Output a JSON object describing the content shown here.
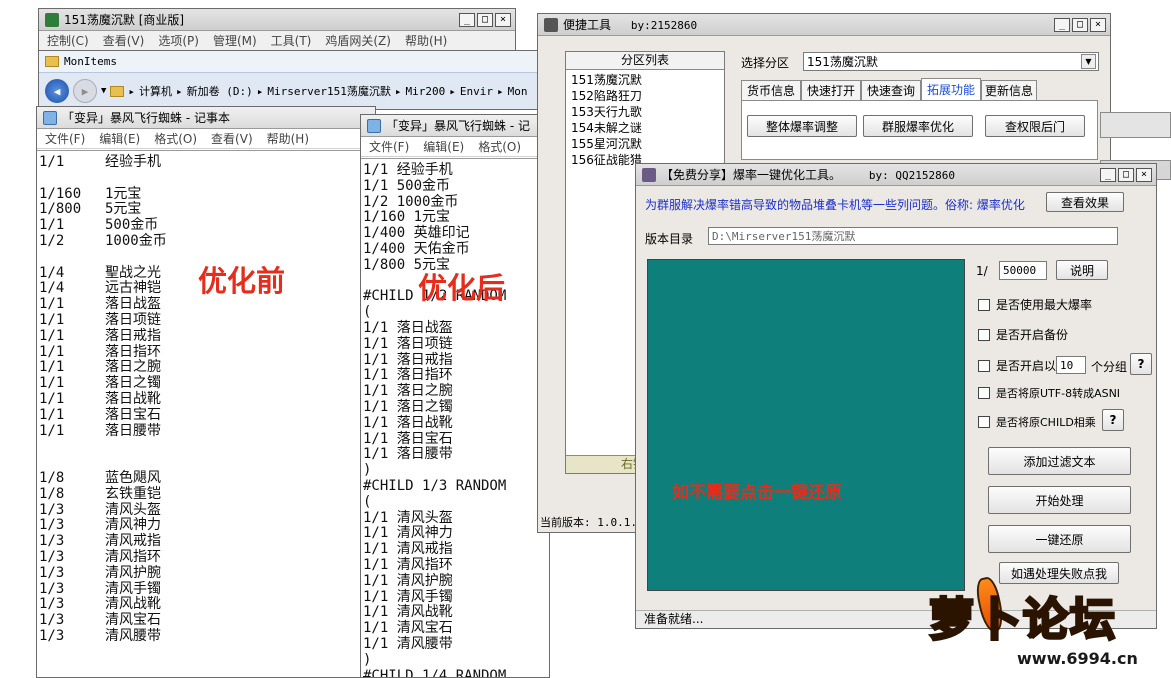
{
  "colors": {
    "overlay_red": "#e52d1c",
    "teal_panel": "#0e7f7a",
    "info_blue": "#1a2fc9",
    "logo_orange": "#ff7a10"
  },
  "game_window": {
    "title": "151荡魔沉默 [商业版]",
    "menu": [
      "控制(C)",
      "查看(V)",
      "选项(P)",
      "管理(M)",
      "工具(T)",
      "鸡盾网关(Z)",
      "帮助(H)"
    ]
  },
  "explorer": {
    "folder_title": "MonItems",
    "breadcrumb": [
      "计算机",
      "新加卷 (D:)",
      "Mirserver151荡魔沉默",
      "Mir200",
      "Envir",
      "Mon"
    ]
  },
  "notepad_before": {
    "title": "「变异」暴风飞行蜘蛛 - 记事本",
    "menu": [
      "文件(F)",
      "编辑(E)",
      "格式(O)",
      "查看(V)",
      "帮助(H)"
    ],
    "rows": [
      {
        "r": "1/1",
        "n": "经验手机"
      },
      {
        "r": "",
        "n": ""
      },
      {
        "r": "1/160",
        "n": "1元宝"
      },
      {
        "r": "1/800",
        "n": "5元宝"
      },
      {
        "r": "1/1",
        "n": "500金币"
      },
      {
        "r": "1/2",
        "n": "1000金币"
      },
      {
        "r": "",
        "n": ""
      },
      {
        "r": "1/4",
        "n": "聖战之光"
      },
      {
        "r": "1/4",
        "n": "远古神铠"
      },
      {
        "r": "1/1",
        "n": "落日战盔"
      },
      {
        "r": "1/1",
        "n": "落日项链"
      },
      {
        "r": "1/1",
        "n": "落日戒指"
      },
      {
        "r": "1/1",
        "n": "落日指环"
      },
      {
        "r": "1/1",
        "n": "落日之腕"
      },
      {
        "r": "1/1",
        "n": "落日之镯"
      },
      {
        "r": "1/1",
        "n": "落日战靴"
      },
      {
        "r": "1/1",
        "n": "落日宝石"
      },
      {
        "r": "1/1",
        "n": "落日腰带"
      },
      {
        "r": "",
        "n": ""
      },
      {
        "r": "",
        "n": ""
      },
      {
        "r": "1/8",
        "n": "蓝色飓风"
      },
      {
        "r": "1/8",
        "n": "玄铁重铠"
      },
      {
        "r": "1/3",
        "n": "清风头盔"
      },
      {
        "r": "1/3",
        "n": "清风神力"
      },
      {
        "r": "1/3",
        "n": "清风戒指"
      },
      {
        "r": "1/3",
        "n": "清风指环"
      },
      {
        "r": "1/3",
        "n": "清风护腕"
      },
      {
        "r": "1/3",
        "n": "清风手镯"
      },
      {
        "r": "1/3",
        "n": "清风战靴"
      },
      {
        "r": "1/3",
        "n": "清风宝石"
      },
      {
        "r": "1/3",
        "n": "清风腰带"
      }
    ]
  },
  "notepad_after": {
    "title": "「变异」暴风飞行蜘蛛 - 记",
    "menu": [
      "文件(F)",
      "编辑(E)",
      "格式(O)"
    ],
    "lines": [
      "1/1 经验手机",
      "1/1 500金币",
      "1/2 1000金币",
      "1/160 1元宝",
      "1/400 英雄印记",
      "1/400 天佑金币",
      "1/800 5元宝",
      "",
      "#CHILD 1/2 RANDOM",
      "(",
      "1/1 落日战盔",
      "1/1 落日项链",
      "1/1 落日戒指",
      "1/1 落日指环",
      "1/1 落日之腕",
      "1/1 落日之镯",
      "1/1 落日战靴",
      "1/1 落日宝石",
      "1/1 落日腰带",
      ")",
      "#CHILD 1/3 RANDOM",
      "(",
      "1/1 清风头盔",
      "1/1 清风神力",
      "1/1 清风戒指",
      "1/1 清风指环",
      "1/1 清风护腕",
      "1/1 清风手镯",
      "1/1 清风战靴",
      "1/1 清风宝石",
      "1/1 清风腰带",
      ")",
      "#CHILD 1/4 RANDOM"
    ]
  },
  "labels": {
    "before": "优化前",
    "after": "优化后",
    "restore_hint": "如不需要点击一键还原"
  },
  "quick_tool": {
    "title": "便捷工具",
    "author": "by:2152860",
    "partition_list_header": "分区列表",
    "partitions": [
      "151荡魔沉默",
      "152陷路狂刀",
      "153天行九歌",
      "154未解之谜",
      "155星河沉默",
      "156征战能猎"
    ],
    "list_footer": "右键增删",
    "select_label": "选择分区",
    "selected_partition": "151荡魔沉默",
    "tabs": [
      "货币信息",
      "快速打开",
      "快速查询",
      "拓展功能",
      "更新信息"
    ],
    "active_tab": 3,
    "buttons": [
      "整体爆率调整",
      "群服爆率优化",
      "查权限后门"
    ],
    "version": "当前版本: 1.0.1."
  },
  "optimizer": {
    "title": "【免费分享】爆率一键优化工具。",
    "author": "by: QQ2152860",
    "info": "为群服解决爆率错高导致的物品堆叠卡机等一些列问题。俗称: 爆率优化",
    "view_effect": "查看效果",
    "dir_label": "版本目录",
    "dir_value": "D:\\Mirserver151荡魔沉默",
    "ratio_prefix": "1/",
    "ratio_value": "50000",
    "explain": "说明",
    "options": [
      "是否使用最大爆率",
      "是否开启备份",
      "是否开启以",
      "是否将原UTF-8转成ASNI",
      "是否将原CHILD相乘"
    ],
    "group_count": "10",
    "group_suffix": "个分组",
    "help": "?",
    "actions": [
      "添加过滤文本",
      "开始处理",
      "一键还原",
      "如遇处理失败点我"
    ],
    "status": "准备就绪..."
  },
  "watermark": {
    "brand": "萝卜论坛",
    "url": "www.6994.cn"
  }
}
